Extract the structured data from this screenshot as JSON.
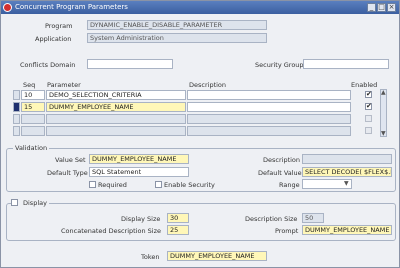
{
  "window": {
    "title": "Concurrent Program Parameters"
  },
  "header": {
    "program_label": "Program",
    "program_value": "DYNAMIC_ENABLE_DISABLE_PARAMETER",
    "application_label": "Application",
    "application_value": "System Administration",
    "conflicts_label": "Conflicts Domain",
    "conflicts_value": "",
    "security_label": "Security Group",
    "security_value": ""
  },
  "grid": {
    "columns": {
      "seq": "Seq",
      "parameter": "Parameter",
      "description": "Description",
      "enabled": "Enabled"
    },
    "rows": [
      {
        "seq": "10",
        "parameter": "DEMO_SELECTION_CRITERIA",
        "description": "",
        "enabled": true
      },
      {
        "seq": "15",
        "parameter": "DUMMY_EMPLOYEE_NAME",
        "description": "",
        "enabled": true
      },
      {
        "seq": "",
        "parameter": "",
        "description": "",
        "enabled": false
      },
      {
        "seq": "",
        "parameter": "",
        "description": "",
        "enabled": false
      }
    ]
  },
  "validation": {
    "title": "Validation",
    "value_set_label": "Value Set",
    "value_set": "DUMMY_EMPLOYEE_NAME",
    "default_type_label": "Default Type",
    "default_type": "SQL Statement",
    "required_label": "Required",
    "enable_security_label": "Enable Security",
    "description_label": "Description",
    "description": "",
    "default_value_label": "Default Value",
    "default_value": "SELECT DECODE( $FLEX$.DE",
    "range_label": "Range",
    "range": ""
  },
  "display": {
    "title": "Display",
    "display_size_label": "Display Size",
    "display_size": "30",
    "concat_size_label": "Concatenated Description Size",
    "concat_size": "25",
    "desc_size_label": "Description Size",
    "desc_size": "50",
    "prompt_label": "Prompt",
    "prompt": "DUMMY_EMPLOYEE_NAME"
  },
  "token": {
    "label": "Token",
    "value": "DUMMY_EMPLOYEE_NAME"
  },
  "icons": {
    "app": "oracle-icon",
    "minimize": "minimize-icon",
    "maximize": "maximize-icon",
    "close": "close-icon"
  }
}
